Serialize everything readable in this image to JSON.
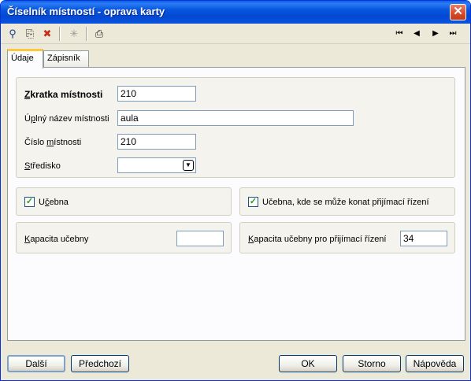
{
  "window": {
    "title": "Číselník místností - oprava karty",
    "close_glyph": "✕"
  },
  "toolbar": {
    "icons": [
      "search-icon",
      "copy-icon",
      "delete-icon",
      "settings-icon",
      "print-icon"
    ],
    "icon_glyphs": [
      "⚲",
      "⎘",
      "✖",
      "✳",
      "⎙"
    ],
    "nav": {
      "first": "⏮",
      "prev": "◀",
      "next": "▶",
      "last": "⏭"
    }
  },
  "tabs": [
    {
      "label": "Údaje",
      "active": true
    },
    {
      "label": "Zápisník",
      "active": false
    }
  ],
  "form": {
    "zkratka": {
      "label_u": "Z",
      "label_rest": "kratka místnosti",
      "value": "210"
    },
    "nazev": {
      "label_pre": "Ú",
      "label_u": "p",
      "label_rest": "lný název místnosti",
      "value": "aula"
    },
    "cislo": {
      "label_pre": "Číslo ",
      "label_u": "m",
      "label_rest": "ístnosti",
      "value": "210"
    },
    "stredisko": {
      "label_u": "S",
      "label_rest": "tředisko",
      "value": "",
      "arrow": "▼"
    }
  },
  "checks": {
    "ucebna": {
      "label_pre": "U",
      "label_u": "č",
      "label_rest": "ebna",
      "checked": true,
      "mark": "✓"
    },
    "ucebna_prijimaci": {
      "label": "Učebna, kde se může konat přijímací řízení",
      "checked": true,
      "mark": "✓"
    }
  },
  "capacity": {
    "kapacita": {
      "label_u": "K",
      "label_rest": "apacita učebny",
      "value": ""
    },
    "kapacita_prijimaci": {
      "label_u": "K",
      "label_rest": "apacita učebny pro přijímací řízení",
      "value": "34"
    }
  },
  "buttons": {
    "dalsi": "Další",
    "predchozi": "Předchozí",
    "ok": "OK",
    "storno": "Storno",
    "napoveda": "Nápověda"
  }
}
